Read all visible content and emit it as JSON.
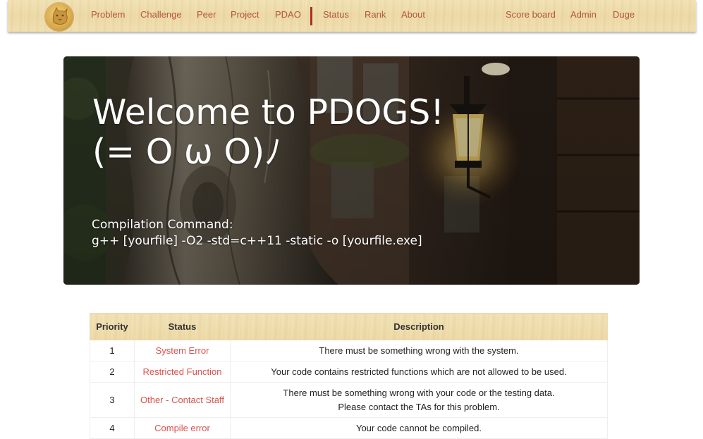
{
  "nav": {
    "items": [
      {
        "label": "Problem"
      },
      {
        "label": "Challenge"
      },
      {
        "label": "Peer"
      },
      {
        "label": "Project"
      },
      {
        "label": "PDAO"
      },
      {
        "label": "Status"
      },
      {
        "label": "Rank"
      },
      {
        "label": "About"
      }
    ],
    "right_items": [
      {
        "label": "Score board"
      },
      {
        "label": "Admin"
      },
      {
        "label": "Duge"
      }
    ]
  },
  "hero": {
    "title_line1": "Welcome to PDOGS!",
    "title_line2": "(= O ω O)ﾉ",
    "cmd_label": "Compilation Command:",
    "cmd_text": "g++ [yourfile] -O2 -std=c++11 -static -o [yourfile.exe]"
  },
  "table": {
    "headers": [
      "Priority",
      "Status",
      "Description"
    ],
    "rows": [
      {
        "priority": "1",
        "status": "System Error",
        "desc": [
          "There must be something wrong with the system."
        ]
      },
      {
        "priority": "2",
        "status": "Restricted Function",
        "desc": [
          "Your code contains restricted functions which are not allowed to be used."
        ]
      },
      {
        "priority": "3",
        "status": "Other - Contact Staff",
        "desc": [
          "There must be something wrong with your code or the testing data.",
          "Please contact the TAs for this problem."
        ]
      },
      {
        "priority": "4",
        "status": "Compile error",
        "desc": [
          "Your code cannot be compiled."
        ]
      }
    ]
  },
  "colors": {
    "nav_link": "#b15640",
    "status_text": "#d9534f",
    "divider": "#a8321e"
  }
}
